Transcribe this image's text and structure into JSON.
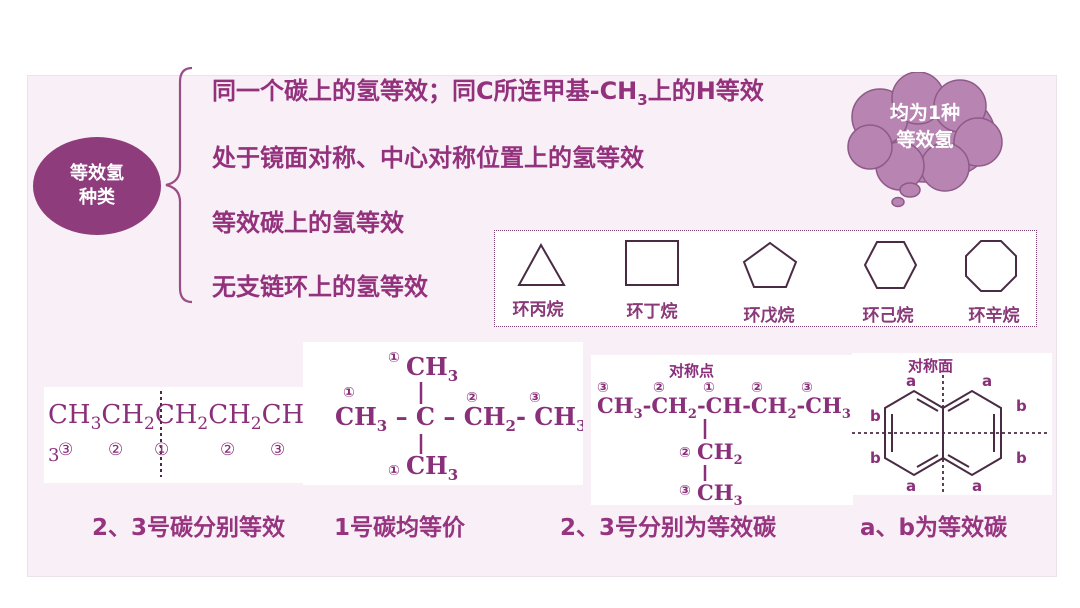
{
  "category": {
    "line1": "等效氢",
    "line2": "种类"
  },
  "rules": [
    {
      "pre": "同一个碳上的氢等效；同C所连甲基-CH",
      "sub": "3",
      "post": "上的H等效"
    },
    {
      "pre": "处于镜面对称、中心对称位置上的氢等效",
      "sub": "",
      "post": ""
    },
    {
      "pre": "等效碳上的氢等效",
      "sub": "",
      "post": ""
    },
    {
      "pre": "无支链环上的氢等效",
      "sub": "",
      "post": ""
    }
  ],
  "cloud": {
    "line1": "均为1种",
    "line2": "等效氢"
  },
  "rings": [
    "环丙烷",
    "环丁烷",
    "环戊烷",
    "环己烷",
    "环辛烷"
  ],
  "captions": [
    "2、3号碳分别等效",
    "1号碳均等价",
    "2、3号分别为等效碳",
    "a、b为等效碳"
  ],
  "struct2": {
    "sym_point": "对称点"
  },
  "struct4": {
    "sym_plane": "对称面"
  },
  "colors": {
    "primary": "#8e3c7c",
    "text": "#93317d",
    "cloud": "#b884b2",
    "panel": "#f8f0f6"
  }
}
